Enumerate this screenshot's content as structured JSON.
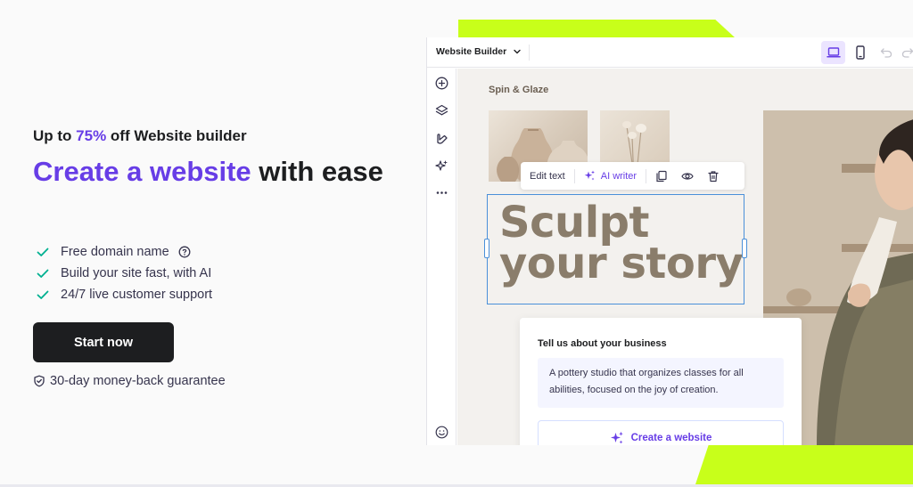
{
  "hero": {
    "promo_prefix": "Up to ",
    "promo_percent": "75%",
    "promo_suffix": " off Website builder",
    "headline_accent": "Create a website",
    "headline_rest": " with ease",
    "features": [
      {
        "label": "Free domain name",
        "has_help": true
      },
      {
        "label": "Build your site fast, with AI",
        "has_help": false
      },
      {
        "label": "24/7 live customer support",
        "has_help": false
      }
    ],
    "cta_label": "Start now",
    "guarantee": "30-day money-back guarantee"
  },
  "builder": {
    "title": "Website Builder",
    "site_name": "Spin & Glaze",
    "heading_line1": "Sculpt",
    "heading_line2": "your story",
    "edit_toolbar": {
      "edit_text": "Edit text",
      "ai_writer": "AI writer"
    },
    "prompt": {
      "label": "Tell us about your business",
      "value": "A pottery studio that organizes classes for all abilities, focused on the joy of creation.",
      "button": "Create a website"
    }
  },
  "colors": {
    "accent": "#673de6",
    "lime": "#c8ff1a",
    "dark": "#1d1e20",
    "check": "#00b090",
    "selection": "#4a90d9"
  }
}
